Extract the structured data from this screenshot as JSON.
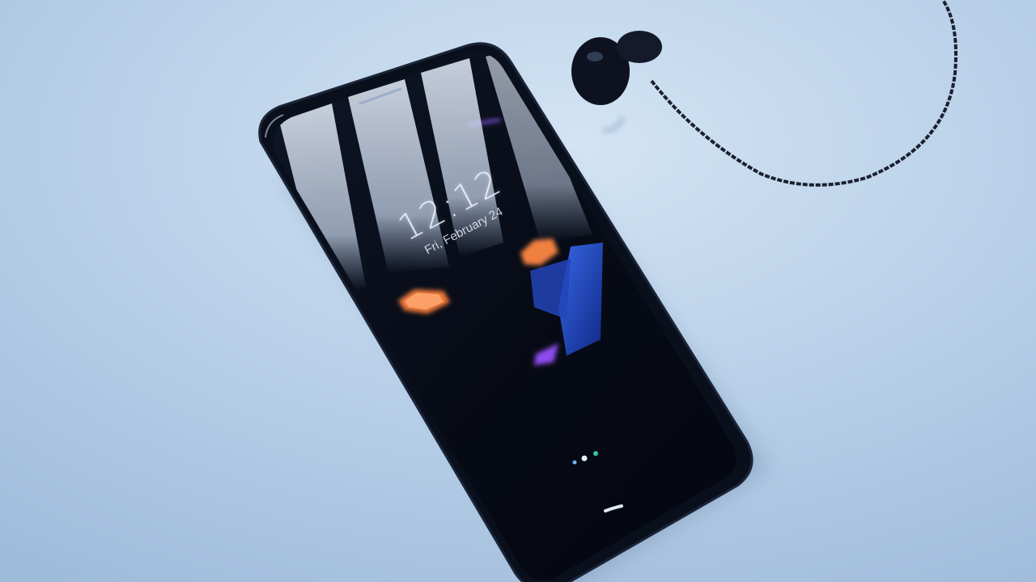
{
  "lock_screen": {
    "time": "12:12",
    "date": "Fri, February 24"
  },
  "colors": {
    "surface": "#b9d1ea",
    "phone_body": "#0a0f1c",
    "screen_dark": "#05070f",
    "accent_orange": "#f07a3c",
    "accent_blue": "#1f4fd8",
    "accent_purple": "#7b3fe0",
    "cable": "#1a2030"
  },
  "objects": {
    "phone": "smartphone-lying-on-table",
    "earphones": "wired-in-ear-earphones"
  }
}
